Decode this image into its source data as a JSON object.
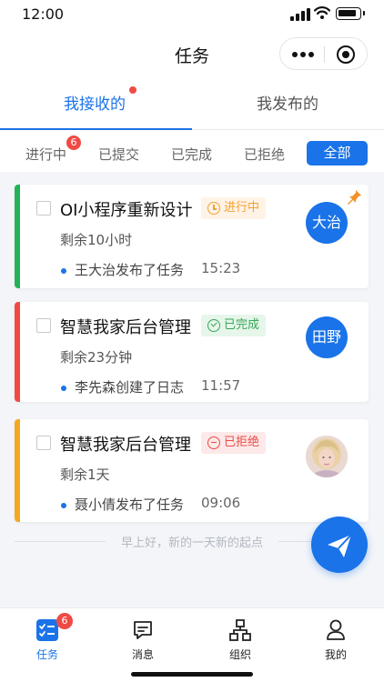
{
  "status_bar": {
    "time": "12:00"
  },
  "navbar": {
    "title": "任务"
  },
  "tabs": [
    {
      "label": "我接收的",
      "active": true,
      "has_dot": true
    },
    {
      "label": "我发布的",
      "active": false
    }
  ],
  "filters": {
    "items": [
      "进行中",
      "已提交",
      "已完成",
      "已拒绝"
    ],
    "badge": "6",
    "all_label": "全部"
  },
  "tasks": [
    {
      "title": "OI小程序重新设计",
      "status": "进行中",
      "remaining": "剩余10小时",
      "log": "王大治发布了任务",
      "time": "15:23",
      "avatar": "大治",
      "pinned": true,
      "stripe_color": "#23b356"
    },
    {
      "title": "智慧我家后台管理",
      "status": "已完成",
      "remaining": "剩余23分钟",
      "log": "李先森创建了日志",
      "time": "11:57",
      "avatar": "田野",
      "pinned": false,
      "stripe_color": "#f04a45"
    },
    {
      "title": "智慧我家后台管理",
      "status": "已拒绝",
      "remaining": "剩余1天",
      "log": "聂小倩发布了任务",
      "time": "09:06",
      "avatar": "",
      "pinned": false,
      "stripe_color": "#f5a623"
    }
  ],
  "footnote": "早上好，新的一天新的起点",
  "tabbar": [
    {
      "label": "任务",
      "active": true,
      "badge": "6",
      "icon": "task-icon"
    },
    {
      "label": "消息",
      "active": false,
      "icon": "message-icon"
    },
    {
      "label": "组织",
      "active": false,
      "icon": "organization-icon"
    },
    {
      "label": "我的",
      "active": false,
      "icon": "profile-icon"
    }
  ],
  "colors": {
    "accent": "#1a73e8",
    "badge": "#f04a45",
    "progress": "#f5a033",
    "done": "#3aa757",
    "reject": "#ea4a45"
  }
}
